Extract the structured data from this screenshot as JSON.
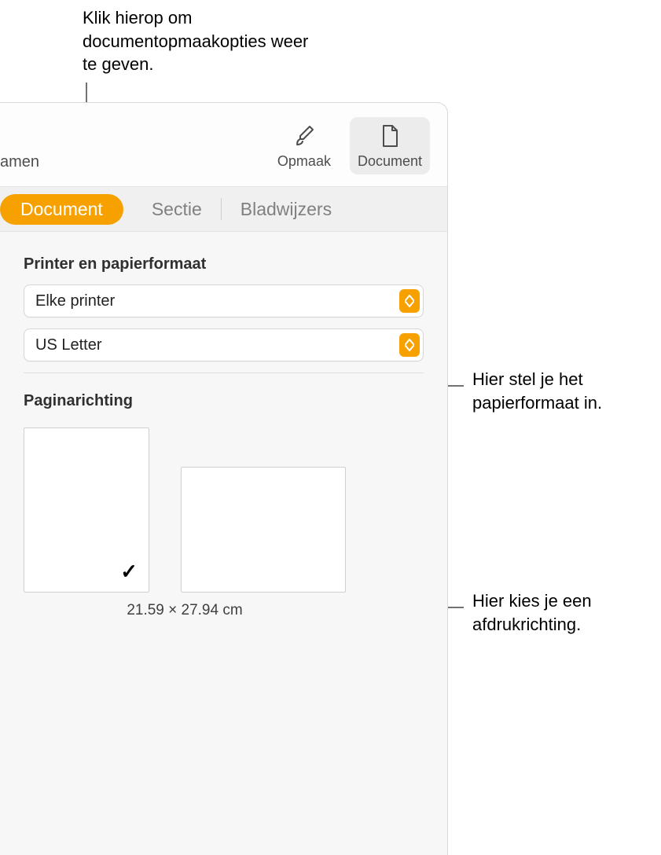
{
  "callouts": {
    "top": "Klik hierop om documentopmaakopties weer te geven.",
    "paper": "Hier stel je het papierformaat in.",
    "orient": "Hier kies je een afdrukrichting."
  },
  "toolbar": {
    "left_partial": "amen",
    "format_label": "Opmaak",
    "document_label": "Document"
  },
  "tabs": {
    "document": "Document",
    "section": "Sectie",
    "bookmarks": "Bladwijzers"
  },
  "printer_section": {
    "title": "Printer en papierformaat",
    "printer_value": "Elke printer",
    "paper_value": "US Letter"
  },
  "orientation_section": {
    "title": "Paginarichting",
    "dimensions": "21.59 × 27.94 cm"
  }
}
